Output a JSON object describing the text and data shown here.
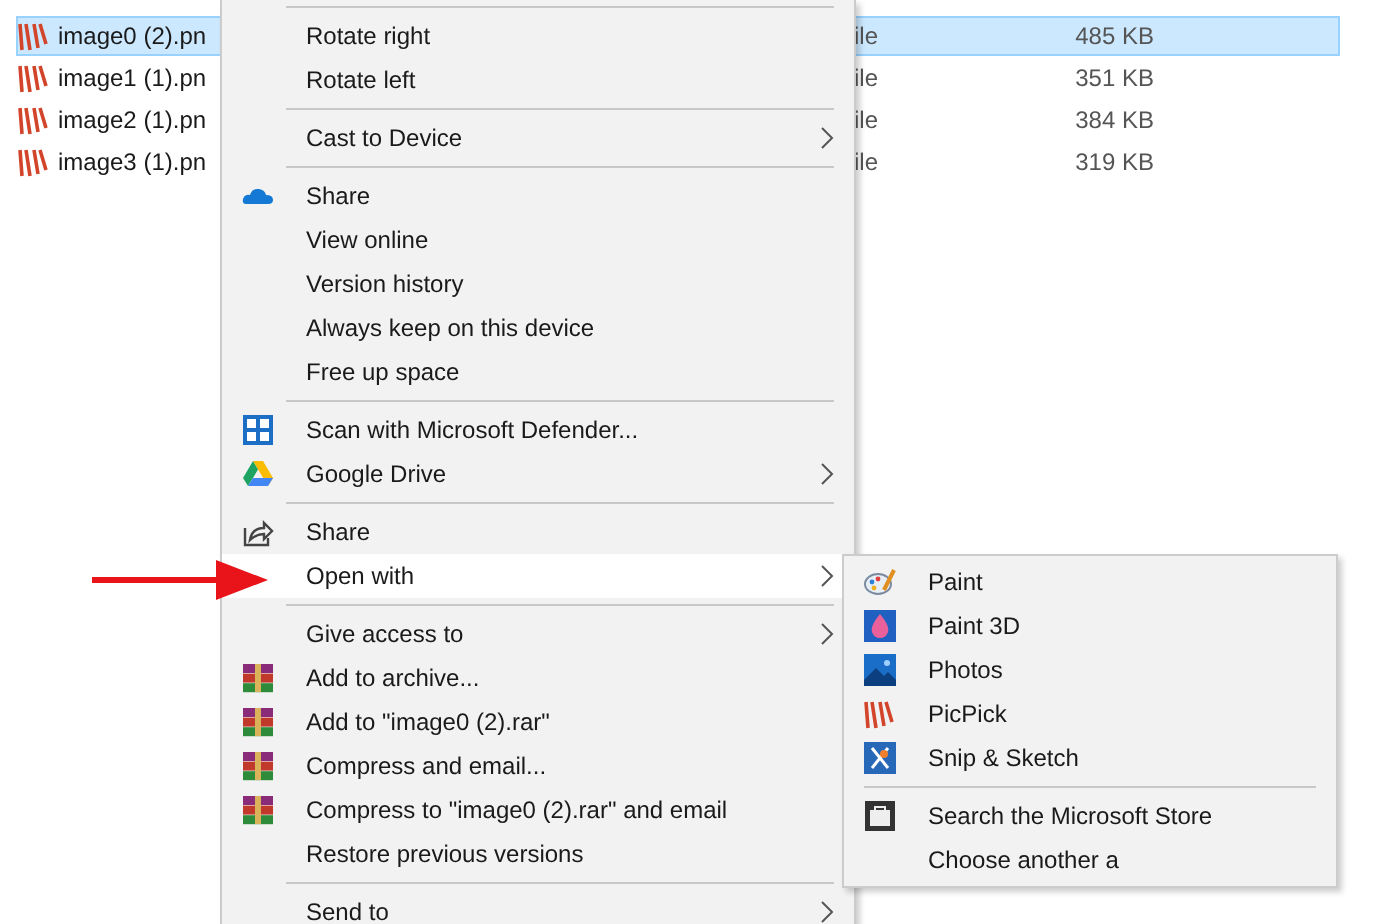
{
  "files": [
    {
      "name": "image0 (2).pn",
      "type": "ile",
      "size": "485 KB",
      "selected": true
    },
    {
      "name": "image1 (1).pn",
      "type": "ile",
      "size": "351 KB",
      "selected": false
    },
    {
      "name": "image2 (1).pn",
      "type": "ile",
      "size": "384 KB",
      "selected": false
    },
    {
      "name": "image3 (1).pn",
      "type": "ile",
      "size": "319 KB",
      "selected": false
    }
  ],
  "context_menu": [
    {
      "kind": "separator"
    },
    {
      "kind": "item",
      "label": "Rotate right"
    },
    {
      "kind": "item",
      "label": "Rotate left"
    },
    {
      "kind": "separator"
    },
    {
      "kind": "item",
      "label": "Cast to Device",
      "submenu": true
    },
    {
      "kind": "separator"
    },
    {
      "kind": "item",
      "label": "Share"
    },
    {
      "kind": "item",
      "label": "View online"
    },
    {
      "kind": "item",
      "label": "Version history"
    },
    {
      "kind": "item",
      "label": "Always keep on this device"
    },
    {
      "kind": "item",
      "label": "Free up space"
    },
    {
      "kind": "separator"
    },
    {
      "kind": "item",
      "label": "Scan with Microsoft Defender..."
    },
    {
      "kind": "item",
      "label": "Google Drive",
      "submenu": true
    },
    {
      "kind": "separator"
    },
    {
      "kind": "item",
      "label": "Share"
    },
    {
      "kind": "item",
      "label": "Open with",
      "submenu": true,
      "highlighted": true
    },
    {
      "kind": "separator"
    },
    {
      "kind": "item",
      "label": "Give access to",
      "submenu": true
    },
    {
      "kind": "item",
      "label": "Add to archive..."
    },
    {
      "kind": "item",
      "label": "Add to \"image0 (2).rar\""
    },
    {
      "kind": "item",
      "label": "Compress and email..."
    },
    {
      "kind": "item",
      "label": "Compress to \"image0 (2).rar\" and email"
    },
    {
      "kind": "item",
      "label": "Restore previous versions"
    },
    {
      "kind": "separator"
    },
    {
      "kind": "item",
      "label": "Send to",
      "submenu": true
    }
  ],
  "open_with_submenu": [
    {
      "kind": "item",
      "label": "Paint"
    },
    {
      "kind": "item",
      "label": "Paint 3D"
    },
    {
      "kind": "item",
      "label": "Photos"
    },
    {
      "kind": "item",
      "label": "PicPick"
    },
    {
      "kind": "item",
      "label": "Snip & Sketch"
    },
    {
      "kind": "separator"
    },
    {
      "kind": "item",
      "label": "Search the Microsoft Store"
    },
    {
      "kind": "item",
      "label": "Choose another a"
    }
  ]
}
